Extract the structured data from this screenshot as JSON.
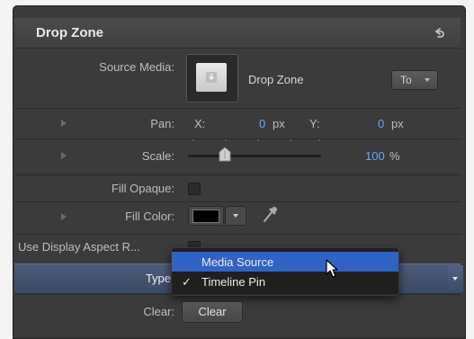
{
  "header": {
    "title": "Drop Zone",
    "reset_icon": "reset-arrow-icon"
  },
  "source_media": {
    "label": "Source Media:",
    "name": "Drop Zone",
    "to_label": "To",
    "thumbnail_icon": "drop-zone-thumbnail-icon"
  },
  "pan": {
    "label": "Pan:",
    "x_label": "X:",
    "x_value": "0",
    "x_unit": "px",
    "y_label": "Y:",
    "y_value": "0",
    "y_unit": "px"
  },
  "scale": {
    "label": "Scale:",
    "value": "100",
    "unit": "%",
    "slider_fraction": 0.25
  },
  "fill_opaque": {
    "label": "Fill Opaque:",
    "checked": false
  },
  "fill_color": {
    "label": "Fill Color:",
    "color": "#000000",
    "eyedropper_icon": "eyedropper-icon"
  },
  "use_display_aspect": {
    "label": "Use Display Aspect R...",
    "checked": false
  },
  "type": {
    "label": "Type",
    "menu": [
      {
        "label": "Media Source",
        "checked": false,
        "highlighted": true
      },
      {
        "label": "Timeline Pin",
        "checked": true,
        "highlighted": false
      }
    ],
    "check_glyph": "✓"
  },
  "clear": {
    "label": "Clear:",
    "button": "Clear"
  },
  "colors": {
    "panel": "#3b3b3b",
    "accent_blue": "#6aa4ff",
    "menu_highlight": "#2f63c4"
  }
}
